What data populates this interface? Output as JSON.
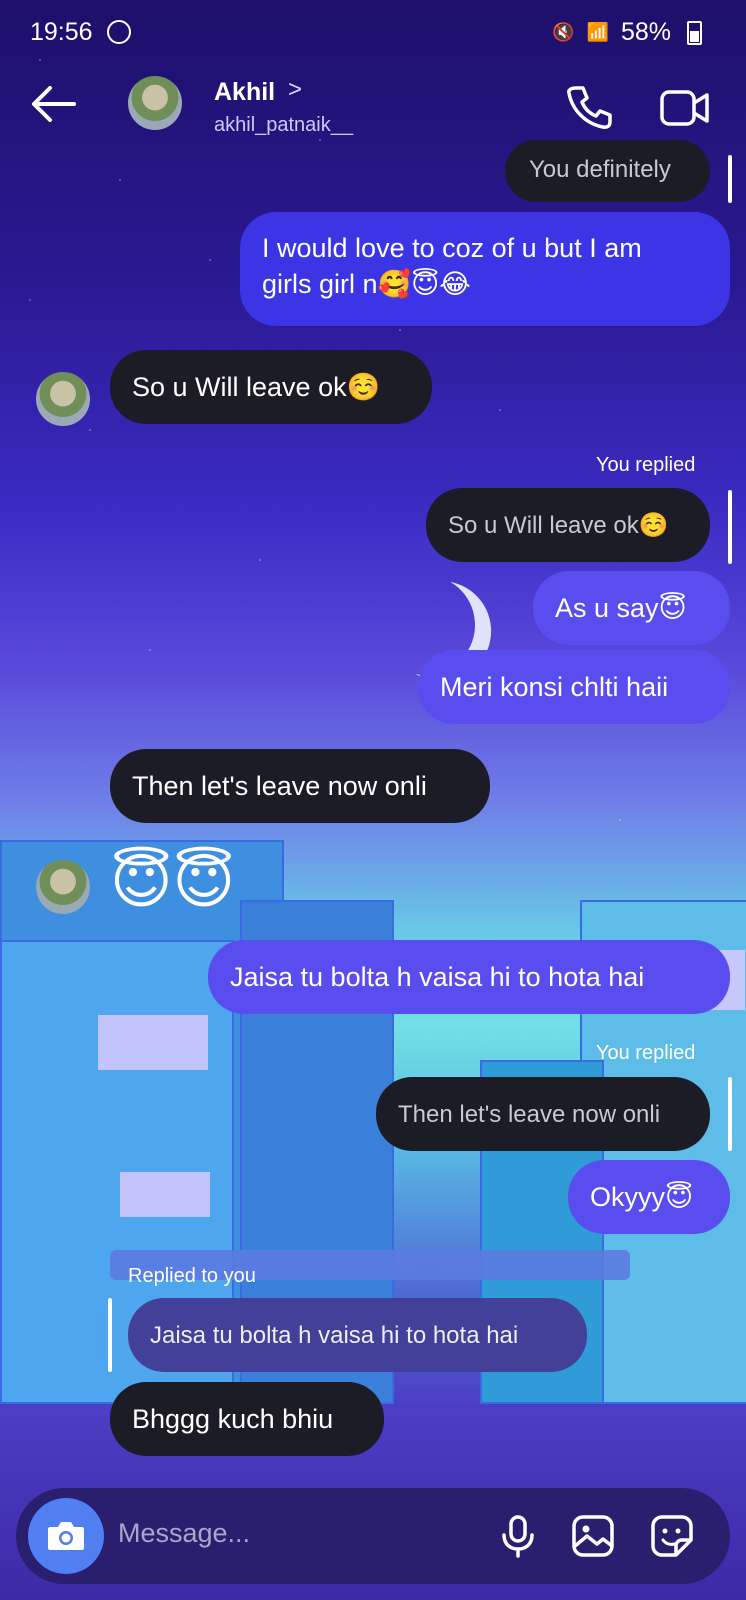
{
  "status_bar": {
    "time": "19:56",
    "battery": "58%"
  },
  "header": {
    "name": "Akhil",
    "chevron": ">",
    "username": "akhil_patnaik__"
  },
  "messages": {
    "m1": "You definitely",
    "m2_line1": "I would love to coz of u but I am",
    "m2_line2": "girls girl n🥰😇😂",
    "m3": "So u Will leave ok☺️",
    "m4_label": "You replied",
    "m4_quote": "So u Will leave ok☺️",
    "m5": "As u say😇",
    "m6": "Meri konsi chlti haii",
    "m7": "Then let's leave now onli",
    "m8": "😇😇",
    "m9": "Jaisa tu bolta h vaisa hi to hota hai",
    "m10_label": "You replied",
    "m10_quote": "Then let's leave now onli",
    "m11": "Okyyy😇",
    "m12_label": "Replied to you",
    "m12_quote": "Jaisa tu bolta h vaisa hi to hota hai",
    "m13": "Bhggg kuch bhiu"
  },
  "composer": {
    "placeholder": "Message..."
  },
  "icons": {
    "back": "arrow-left-icon",
    "call": "phone-icon",
    "video": "video-camera-icon",
    "camera": "camera-icon",
    "mic": "microphone-icon",
    "gallery": "image-icon",
    "sticker": "sticker-icon"
  },
  "colors": {
    "sent": "#3b35e6",
    "received": "#1c1c26",
    "camera_button": "#4f7ff0"
  }
}
